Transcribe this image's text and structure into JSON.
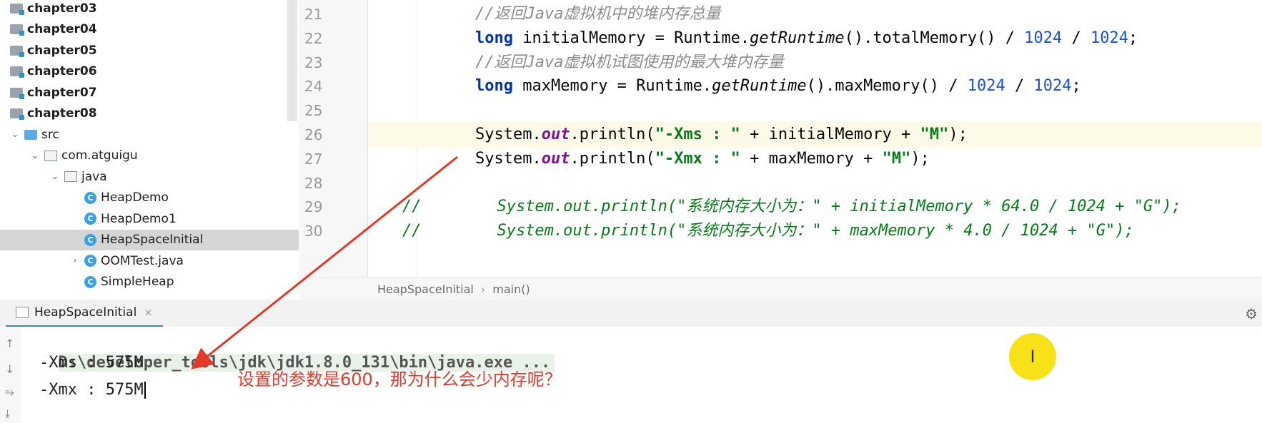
{
  "project_tree": {
    "items": [
      {
        "label": "chapter03",
        "kind": "module"
      },
      {
        "label": "chapter04",
        "kind": "module"
      },
      {
        "label": "chapter05",
        "kind": "module"
      },
      {
        "label": "chapter06",
        "kind": "module"
      },
      {
        "label": "chapter07",
        "kind": "module"
      },
      {
        "label": "chapter08",
        "kind": "module"
      },
      {
        "label": "src",
        "kind": "src-folder",
        "chevron": "v"
      },
      {
        "label": "com.atguigu",
        "kind": "package",
        "chevron": "v"
      },
      {
        "label": "java",
        "kind": "package",
        "chevron": "v"
      },
      {
        "label": "HeapDemo",
        "kind": "class"
      },
      {
        "label": "HeapDemo1",
        "kind": "class"
      },
      {
        "label": "HeapSpaceInitial",
        "kind": "class",
        "selected": true
      },
      {
        "label": "OOMTest.java",
        "kind": "class",
        "chevron": ">"
      },
      {
        "label": "SimpleHeap",
        "kind": "class"
      }
    ]
  },
  "editor": {
    "lines": [
      {
        "num": "21",
        "tokens": [
          [
            "com",
            "//返回Java虚拟机中的堆内存总量"
          ]
        ]
      },
      {
        "num": "22",
        "tokens": [
          [
            "kw",
            "long"
          ],
          [
            "pl",
            " initialMemory = Runtime."
          ],
          [
            "it",
            "getRuntime"
          ],
          [
            "pl",
            "().totalMemory() / "
          ],
          [
            "num",
            "1024"
          ],
          [
            "pl",
            " / "
          ],
          [
            "num",
            "1024"
          ],
          [
            "pl",
            ";"
          ]
        ]
      },
      {
        "num": "23",
        "tokens": [
          [
            "com",
            "//返回Java虚拟机试图使用的最大堆内存量"
          ]
        ]
      },
      {
        "num": "24",
        "tokens": [
          [
            "kw",
            "long"
          ],
          [
            "pl",
            " maxMemory = Runtime."
          ],
          [
            "it",
            "getRuntime"
          ],
          [
            "pl",
            "().maxMemory() / "
          ],
          [
            "num",
            "1024"
          ],
          [
            "pl",
            " / "
          ],
          [
            "num",
            "1024"
          ],
          [
            "pl",
            ";"
          ]
        ]
      },
      {
        "num": "25",
        "tokens": []
      },
      {
        "num": "26",
        "current": true,
        "tokens": [
          [
            "pl",
            "System."
          ],
          [
            "fld",
            "out"
          ],
          [
            "pl",
            ".println("
          ],
          [
            "str",
            "\"-Xms : \""
          ],
          [
            "pl",
            " + initialMemory + "
          ],
          [
            "str",
            "\"M\""
          ],
          [
            "pl",
            ");"
          ]
        ]
      },
      {
        "num": "27",
        "tokens": [
          [
            "pl",
            "System."
          ],
          [
            "fld",
            "out"
          ],
          [
            "pl",
            ".println("
          ],
          [
            "str",
            "\"-Xmx : \""
          ],
          [
            "pl",
            " + maxMemory + "
          ],
          [
            "str",
            "\"M\""
          ],
          [
            "pl",
            ");"
          ]
        ]
      },
      {
        "num": "28",
        "tokens": []
      },
      {
        "num": "29",
        "tokens": [
          [
            "cmt2",
            "//        System.out.println(\"系统内存大小为：\" + initialMemory * 64.0 / 1024 + \"G\");"
          ]
        ]
      },
      {
        "num": "30",
        "tokens": [
          [
            "cmt2",
            "//        System.out.println(\"系统内存大小为：\" + maxMemory * 4.0 / 1024 + \"G\");"
          ]
        ]
      }
    ]
  },
  "breadcrumb": {
    "class": "HeapSpaceInitial",
    "method": "main()",
    "separator": "›"
  },
  "run": {
    "tab_label": "HeapSpaceInitial",
    "close_glyph": "×",
    "command": "D:\\developer_tools\\jdk\\jdk1.8.0_131\\bin\\java.exe ...",
    "output": [
      "-Xms : 575M",
      "-Xmx : 575M"
    ]
  },
  "annotation": {
    "note": "设置的参数是600，那为什么会少内存呢？"
  },
  "icons": {
    "gear": "gear-icon",
    "up": "arrow-up-icon",
    "down": "arrow-down-icon",
    "wrap": "soft-wrap-icon",
    "scroll-end": "scroll-to-end-icon"
  },
  "colors": {
    "annotation": "#e33a2a",
    "highlight_dot": "#f7e21a",
    "keyword": "#0033b3",
    "string": "#067d17"
  }
}
